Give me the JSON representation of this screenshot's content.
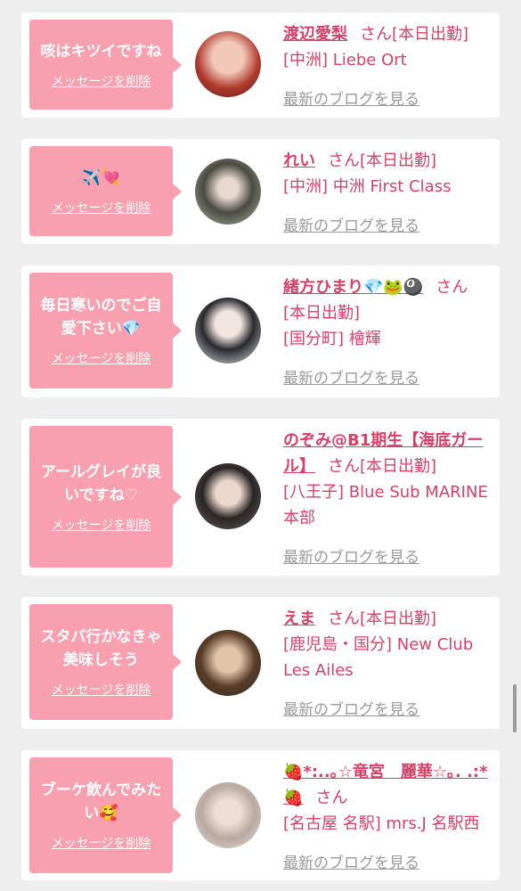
{
  "common": {
    "delete_label": "メッセージを削除",
    "blog_label": "最新のブログを見る",
    "honorific": "さん"
  },
  "cards": [
    {
      "message": "咳はキツイですね",
      "name": "渡辺愛梨",
      "status": "[本日出勤]",
      "shop": "[中洲] Liebe Ort"
    },
    {
      "message": "✈️💘",
      "name": "れい",
      "status": "[本日出勤]",
      "shop": "[中洲] 中洲 First Class"
    },
    {
      "message": "毎日寒いのでご自愛下さい💎",
      "name": "緒方ひまり💎🐸🎱",
      "status": "[本日出勤]",
      "shop": "[国分町] 檜輝"
    },
    {
      "message": "アールグレイが良いですね♡",
      "name": "のぞみ@B1期生【海底ガール】",
      "status": "[本日出勤]",
      "shop": "[八王子] Blue Sub MARINE 本部"
    },
    {
      "message": "スタバ行かなきゃ美味しそう",
      "name": "えま",
      "status": "[本日出勤]",
      "shop": "[鹿児島・国分] New Club Les Ailes"
    },
    {
      "message": "ブーケ飲んでみたい🥰",
      "name": "🍓*:..｡☆竜宮　麗華☆｡. .:*🍓",
      "status": "",
      "shop": "[名古屋 名駅] mrs.J 名駅西"
    }
  ],
  "colors": {
    "accent": "#d94068",
    "bubble": "#f9a0b0",
    "background": "#eeeeee"
  }
}
